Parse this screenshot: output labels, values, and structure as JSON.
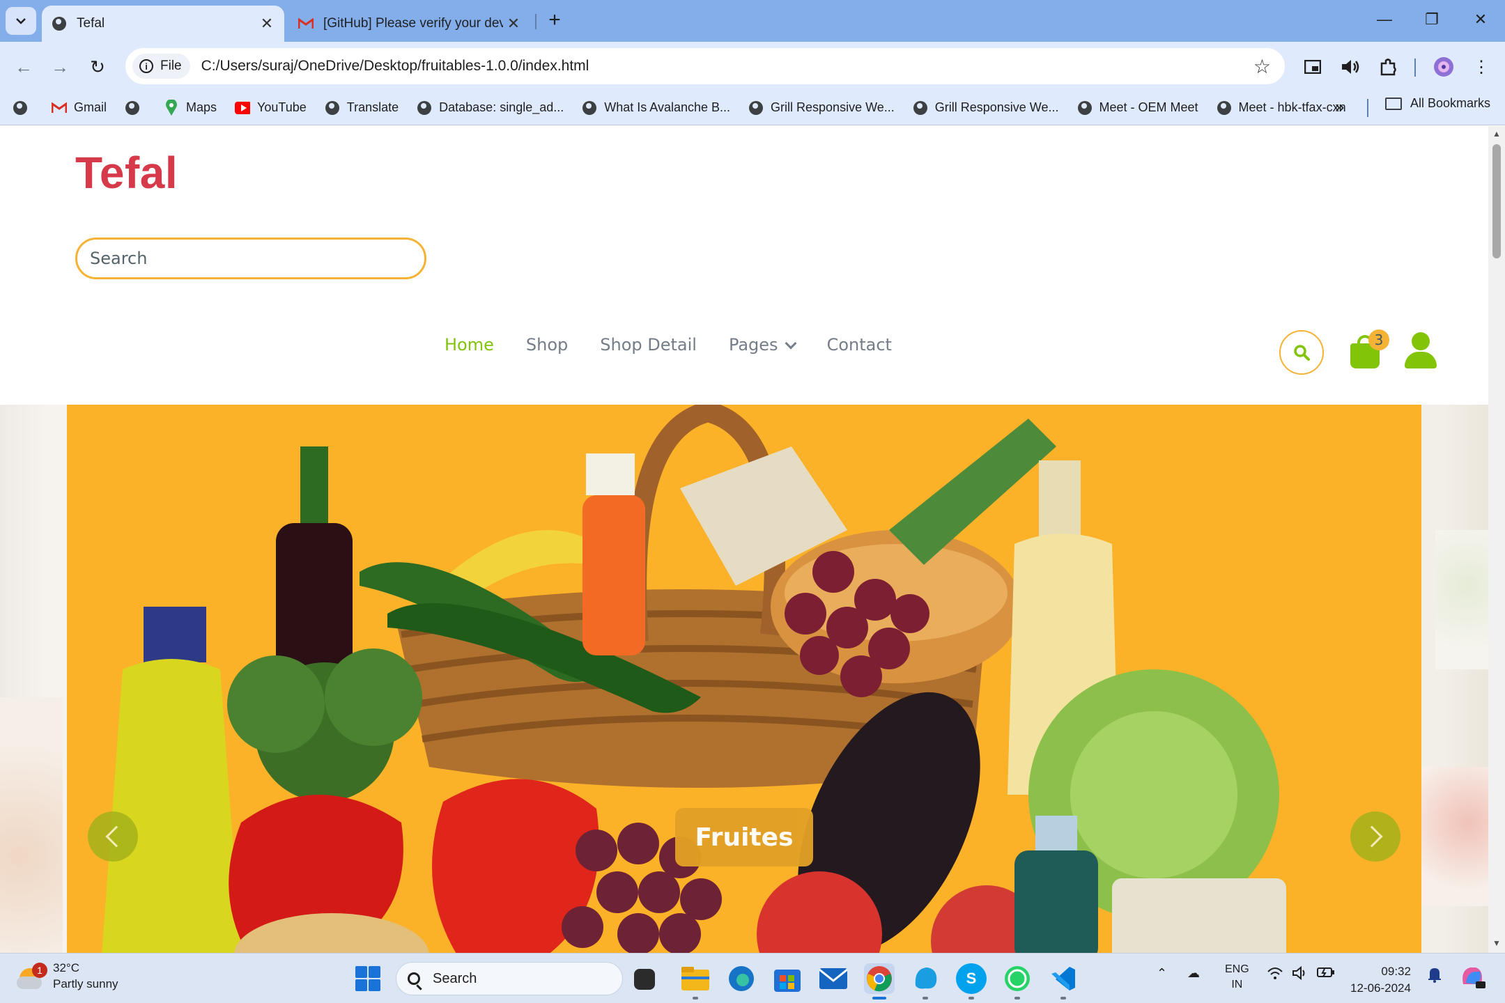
{
  "browser": {
    "tabs": [
      {
        "title": "Tefal",
        "active": true
      },
      {
        "title": "[GitHub] Please verify your devi",
        "active": false
      }
    ],
    "new_tab": "+",
    "address": {
      "chip": "File",
      "url": "C:/Users/suraj/OneDrive/Desktop/fruitables-1.0.0/index.html"
    },
    "bookmarks": [
      {
        "label": "",
        "icon": "globe-icon"
      },
      {
        "label": "Gmail",
        "icon": "gmail-icon"
      },
      {
        "label": "",
        "icon": "globe-icon"
      },
      {
        "label": "Maps",
        "icon": "maps-icon"
      },
      {
        "label": "YouTube",
        "icon": "youtube-icon"
      },
      {
        "label": "Translate",
        "icon": "globe-icon"
      },
      {
        "label": "Database: single_ad...",
        "icon": "globe-icon"
      },
      {
        "label": "What Is Avalanche B...",
        "icon": "globe-icon"
      },
      {
        "label": "Grill Responsive We...",
        "icon": "globe-icon"
      },
      {
        "label": "Grill Responsive We...",
        "icon": "globe-icon"
      },
      {
        "label": "Meet - OEM Meet",
        "icon": "globe-icon"
      },
      {
        "label": "Meet - hbk-tfax-cxn",
        "icon": "globe-icon"
      }
    ],
    "bookmarks_more": "»",
    "all_bookmarks": "All Bookmarks"
  },
  "site": {
    "brand": "Tefal",
    "search_placeholder": "Search",
    "nav": [
      {
        "label": "Home",
        "active": true
      },
      {
        "label": "Shop",
        "active": false
      },
      {
        "label": "Shop Detail",
        "active": false
      },
      {
        "label": "Pages",
        "active": false,
        "dropdown": true
      },
      {
        "label": "Contact",
        "active": false
      }
    ],
    "cart_count": "3",
    "hero": {
      "slide_label": "Fruites"
    }
  },
  "colors": {
    "brand_red": "#d63a4a",
    "accent_green": "#81c408",
    "accent_orange": "#f5b335",
    "hero_bg": "#fbb128"
  },
  "taskbar": {
    "weather_temp": "32°C",
    "weather_cond": "Partly sunny",
    "weather_badge": "1",
    "search_label": "Search",
    "lang_top": "ENG",
    "lang_bottom": "IN",
    "time": "09:32",
    "date": "12-06-2024"
  }
}
